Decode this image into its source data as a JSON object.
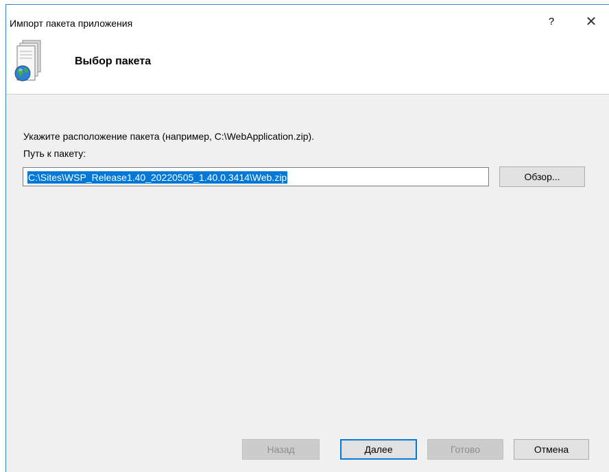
{
  "window": {
    "title": "Импорт пакета приложения",
    "help_label": "?",
    "close_label": "✕"
  },
  "header": {
    "title": "Выбор пакета",
    "icon": "package-globe-icon"
  },
  "main": {
    "instruction": "Укажите расположение пакета (например, C:\\WebApplication.zip).",
    "path_label": "Путь к пакету:",
    "path_value": "C:\\Sites\\WSP_Release1.40_20220505_1.40.0.3414\\Web.zip",
    "browse_label": "Обзор..."
  },
  "footer": {
    "back_label": "Назад",
    "next_label": "Далее",
    "finish_label": "Готово",
    "cancel_label": "Отмена"
  },
  "colors": {
    "accent": "#0078d7",
    "window_border": "#3b7ccf",
    "dialog_bg": "#f0f0f0"
  }
}
